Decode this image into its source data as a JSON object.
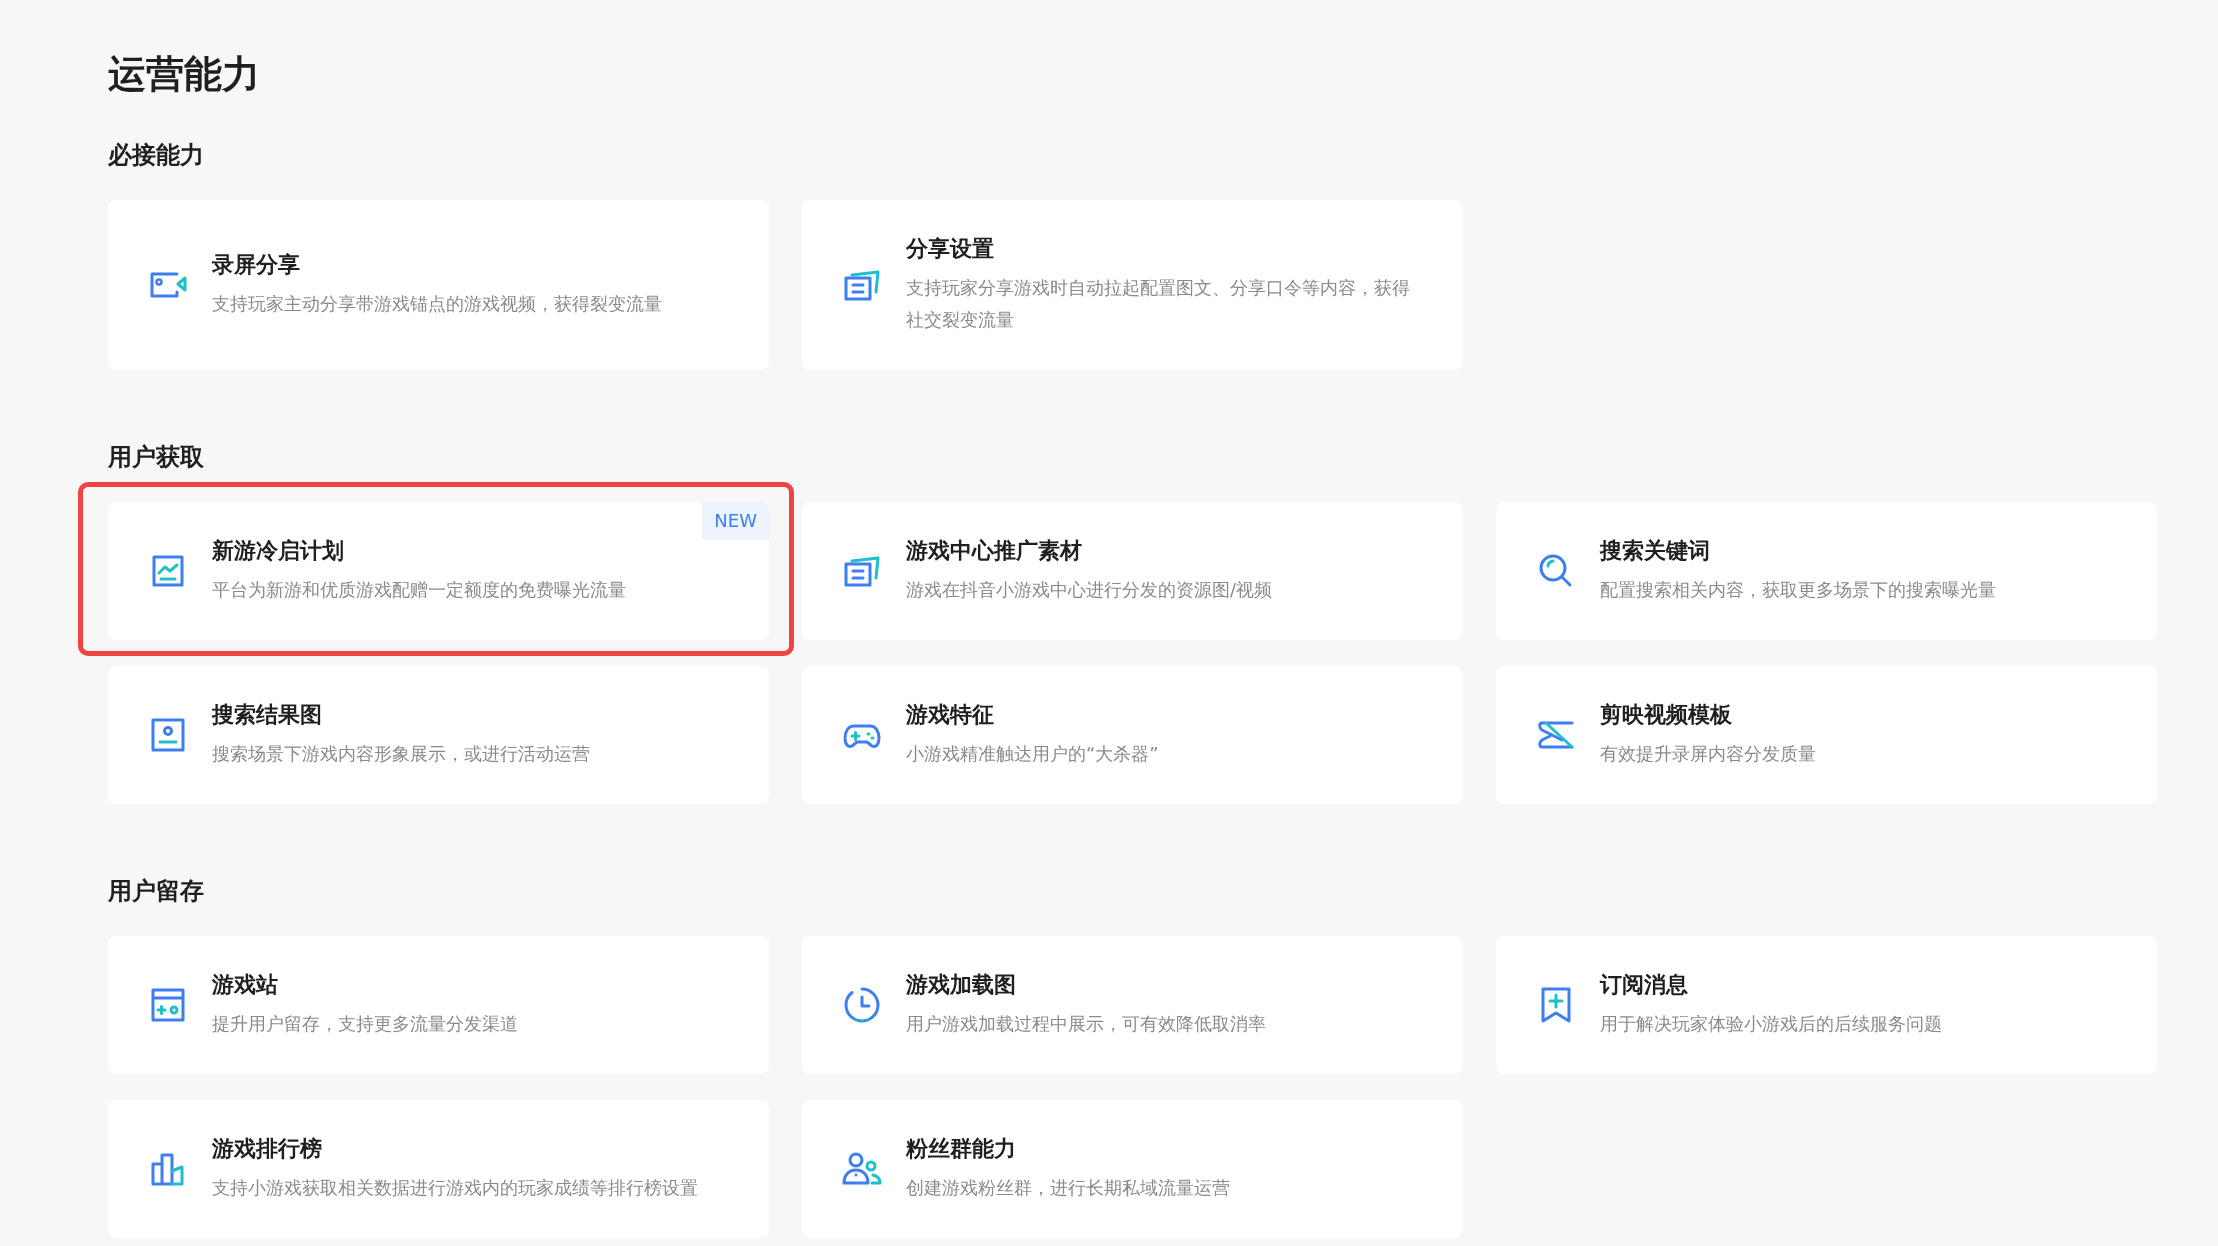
{
  "page_title": "运营能力",
  "sections": [
    {
      "heading": "必接能力",
      "cards": [
        {
          "title": "录屏分享",
          "description": "支持玩家主动分享带游戏锚点的游戏视频，获得裂变流量",
          "highlighted": false
        },
        {
          "title": "分享设置",
          "description": "支持玩家分享游戏时自动拉起配置图文、分享口令等内容，获得社交裂变流量",
          "highlighted": false
        }
      ]
    },
    {
      "heading": "用户获取",
      "cards": [
        {
          "title": "新游冷启计划",
          "description": "平台为新游和优质游戏配赠一定额度的免费曝光流量",
          "badge": "NEW",
          "highlighted": true
        },
        {
          "title": "游戏中心推广素材",
          "description": "游戏在抖音小游戏中心进行分发的资源图/视频",
          "highlighted": false
        },
        {
          "title": "搜索关键词",
          "description": "配置搜索相关内容，获取更多场景下的搜索曝光量",
          "highlighted": false
        },
        {
          "title": "搜索结果图",
          "description": "搜索场景下游戏内容形象展示，或进行活动运营",
          "highlighted": false
        },
        {
          "title": "游戏特征",
          "description": "小游戏精准触达用户的“大杀器”",
          "highlighted": false
        },
        {
          "title": "剪映视频模板",
          "description": "有效提升录屏内容分发质量",
          "highlighted": false
        }
      ]
    },
    {
      "heading": "用户留存",
      "cards": [
        {
          "title": "游戏站",
          "description": "提升用户留存，支持更多流量分发渠道",
          "highlighted": false
        },
        {
          "title": "游戏加载图",
          "description": "用户游戏加载过程中展示，可有效降低取消率",
          "highlighted": false
        },
        {
          "title": "订阅消息",
          "description": "用于解决玩家体验小游戏后的后续服务问题",
          "highlighted": false
        },
        {
          "title": "游戏排行榜",
          "description": "支持小游戏获取相关数据进行游戏内的玩家成绩等排行榜设置",
          "highlighted": false
        },
        {
          "title": "粉丝群能力",
          "description": "创建游戏粉丝群，进行长期私域流量运营",
          "highlighted": false
        }
      ]
    }
  ]
}
